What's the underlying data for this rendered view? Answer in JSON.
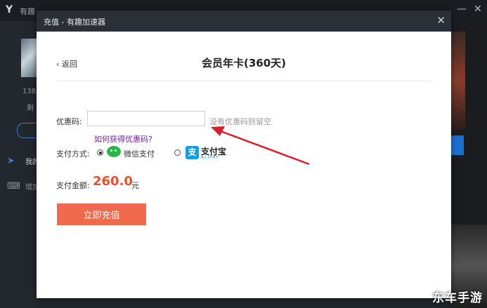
{
  "background_app": {
    "title": "有趣",
    "minimize": "—",
    "close": "✕",
    "sidebar_number": "138",
    "sidebar_char": "剩",
    "nav_items": [
      "我的",
      "增加"
    ],
    "watermark": "东车手游"
  },
  "dialog": {
    "title": "充值 - 有趣加速器",
    "close_label": "✕",
    "back_label": "返回",
    "page_title": "会员年卡(360天)"
  },
  "coupon": {
    "label": "优惠码:",
    "value": "",
    "hint": "没有优惠码则留空",
    "help_link": "如何获得优惠码?"
  },
  "payment": {
    "label": "支付方式:",
    "options": [
      {
        "name": "微信支付",
        "selected": true
      },
      {
        "name": "支付宝",
        "sub": "ALIPAY",
        "selected": false
      }
    ]
  },
  "amount": {
    "label": "支付金额:",
    "value": "260.0",
    "unit": "元"
  },
  "pay_button": "立即充值",
  "colors": {
    "accent_button": "#ef6a4c",
    "amount": "#e8502a",
    "arrow": "#d91f2a",
    "link": "#7a1ea8"
  }
}
